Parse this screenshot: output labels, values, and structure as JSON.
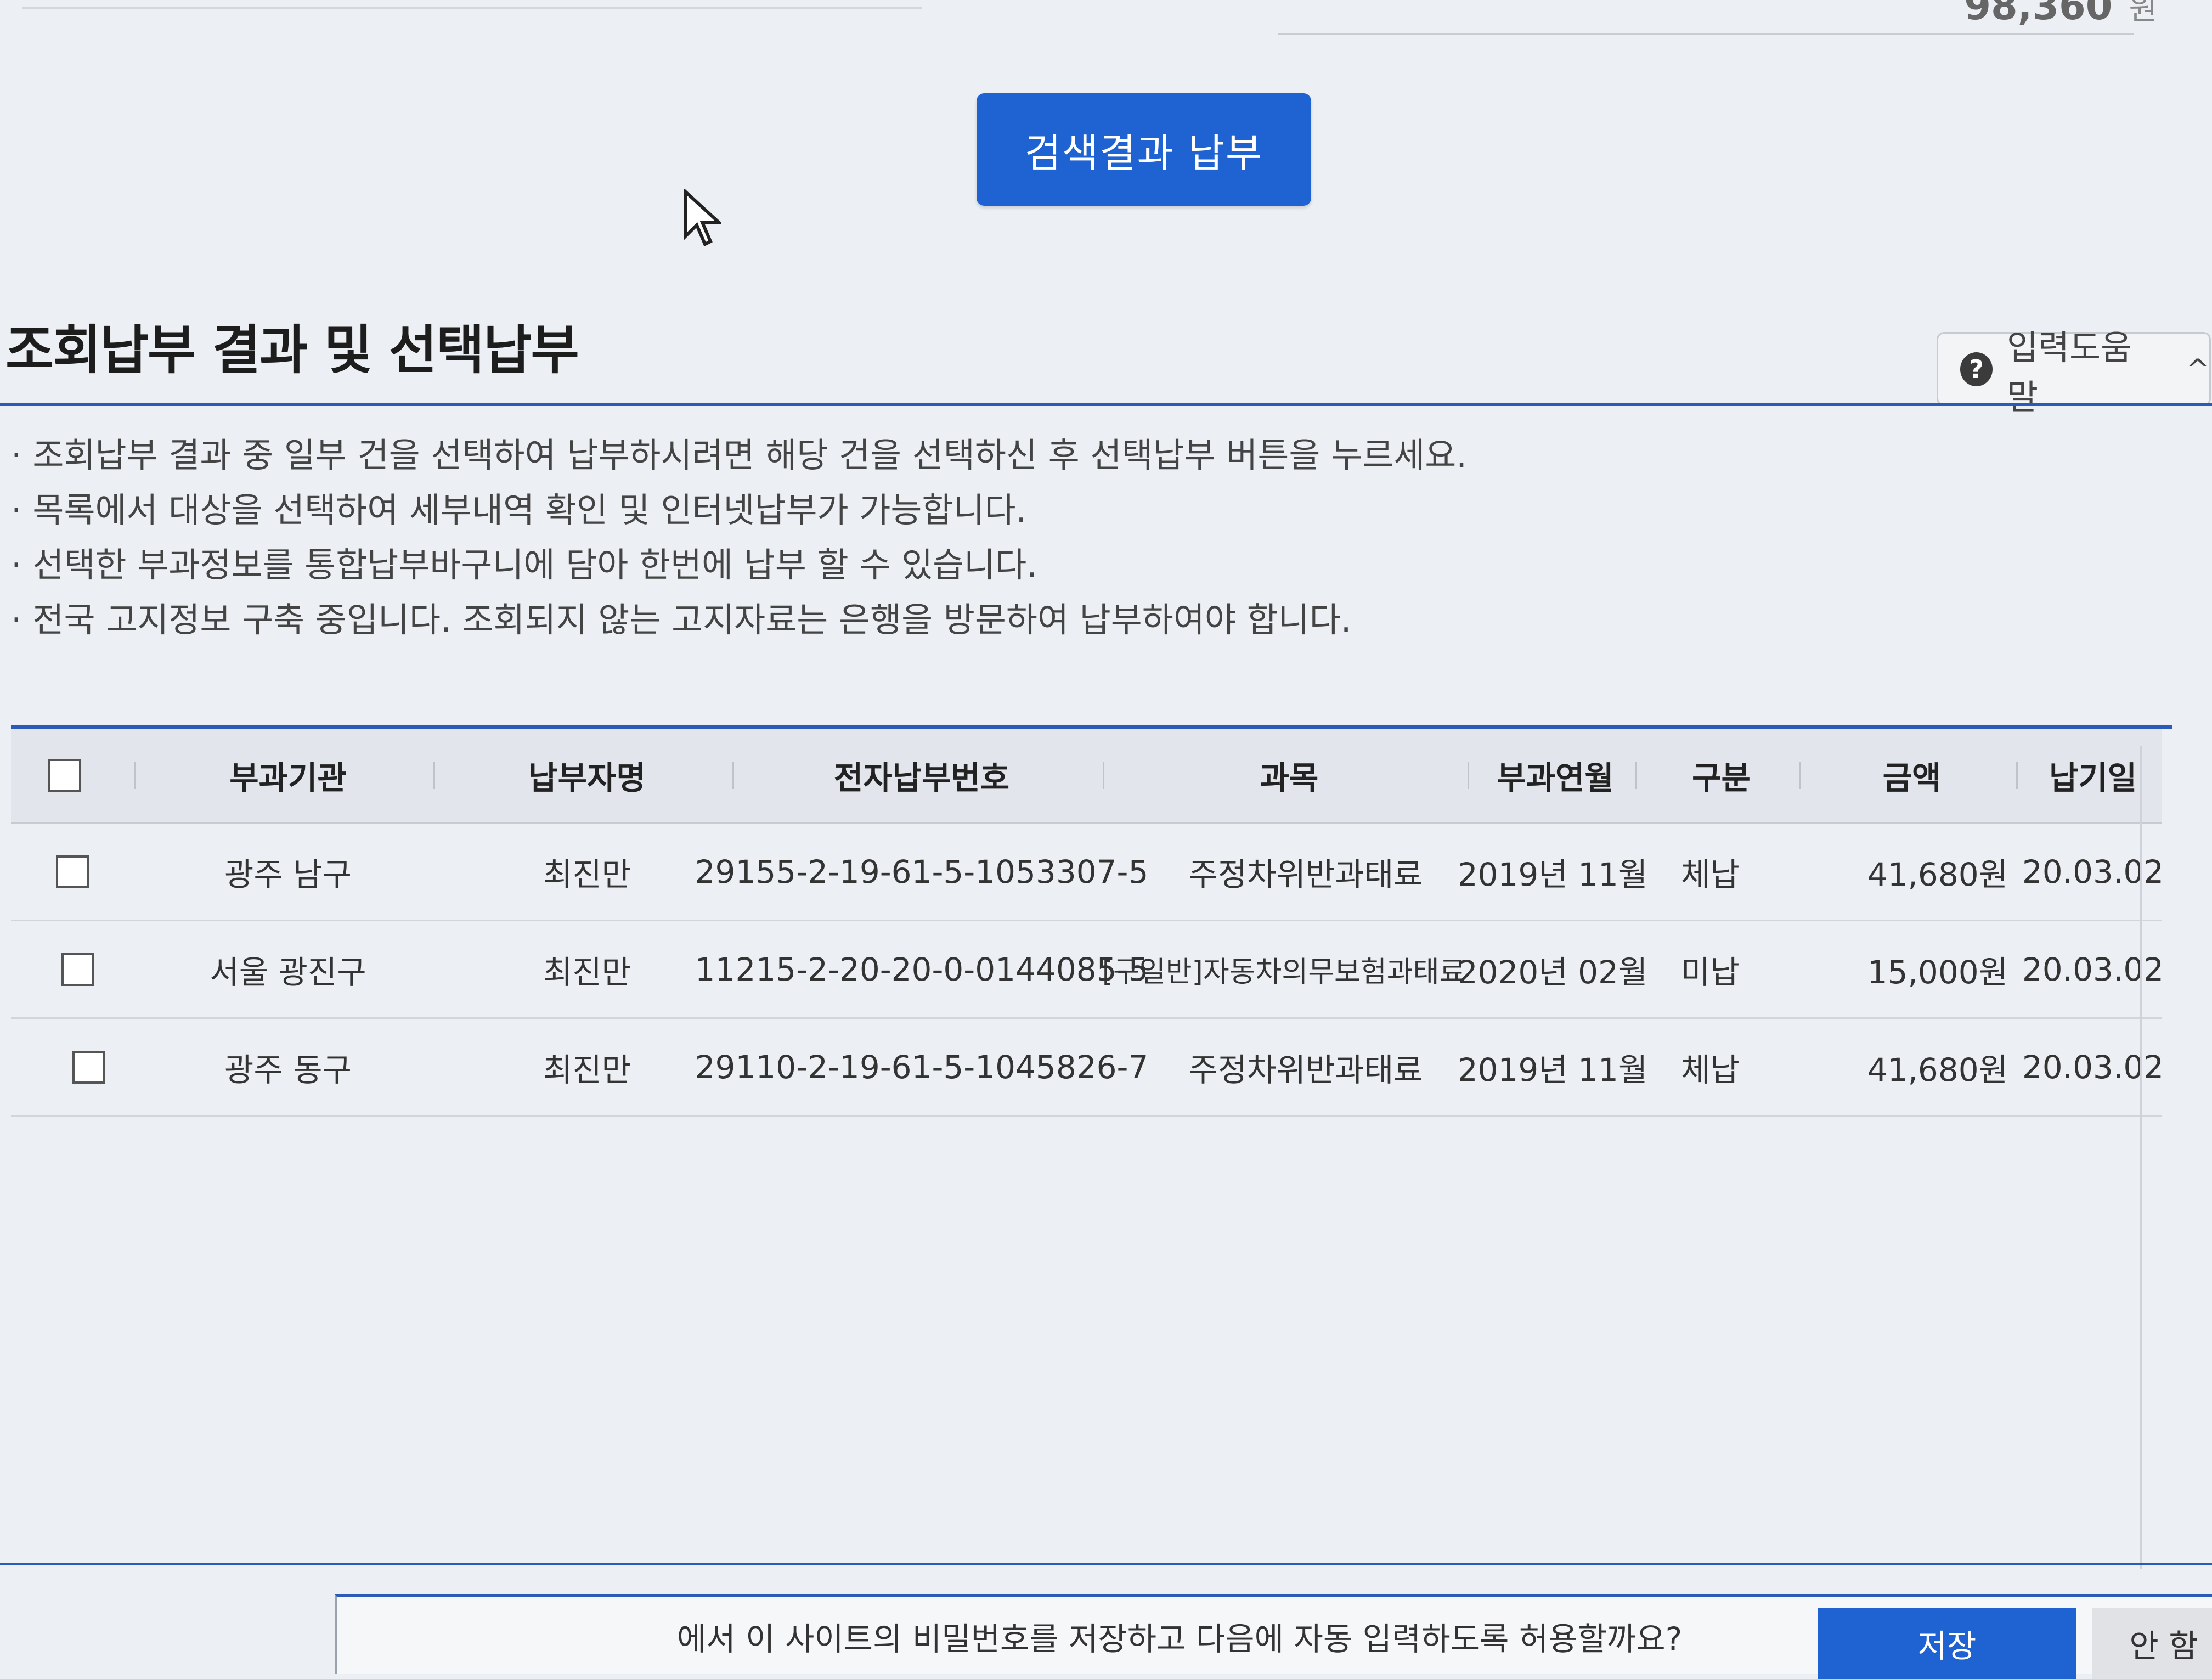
{
  "top": {
    "amount": "98,360",
    "unit": "원"
  },
  "search_button": "검색결과 납부",
  "section": {
    "title": "조회납부 결과 및 선택납부",
    "help_label": "입력도움말",
    "help_icon": "?",
    "help_chevron": "^"
  },
  "notices": [
    "조회납부 결과 중 일부 건을 선택하여 납부하시려면 해당 건을 선택하신 후 선택납부 버튼을 누르세요.",
    "목록에서 대상을 선택하여 세부내역 확인 및 인터넷납부가 가능합니다.",
    "선택한 부과정보를 통합납부바구니에 담아 한번에 납부 할 수 있습니다.",
    "전국 고지정보 구축 중입니다. 조회되지 않는 고지자료는 은행을 방문하여 납부하여야 합니다."
  ],
  "table": {
    "headers": [
      "부과기관",
      "납부자명",
      "전자납부번호",
      "과목",
      "부과연월",
      "구분",
      "금액",
      "납기일"
    ],
    "rows": [
      [
        "광주 남구",
        "최진만",
        "29155-2-19-61-5-1053307-5",
        "주정차위반과태료",
        "2019년 11월",
        "체납",
        "41,680원",
        "20.03.02"
      ],
      [
        "서울 광진구",
        "최진만",
        "11215-2-20-20-0-0144085-5",
        "[구일반]자동차의무보험과태료",
        "2020년 02월",
        "미납",
        "15,000원",
        "20.03.02"
      ],
      [
        "광주 동구",
        "최진만",
        "29110-2-19-61-5-1045826-7",
        "주정차위반과태료",
        "2019년 11월",
        "체납",
        "41,680원",
        "20.03.02"
      ]
    ]
  },
  "password_prompt": {
    "text": "에서 이 사이트의 비밀번호를 저장하고 다음에 자동 입력하도록 허용할까요?",
    "save": "저장",
    "later": "안 함"
  }
}
